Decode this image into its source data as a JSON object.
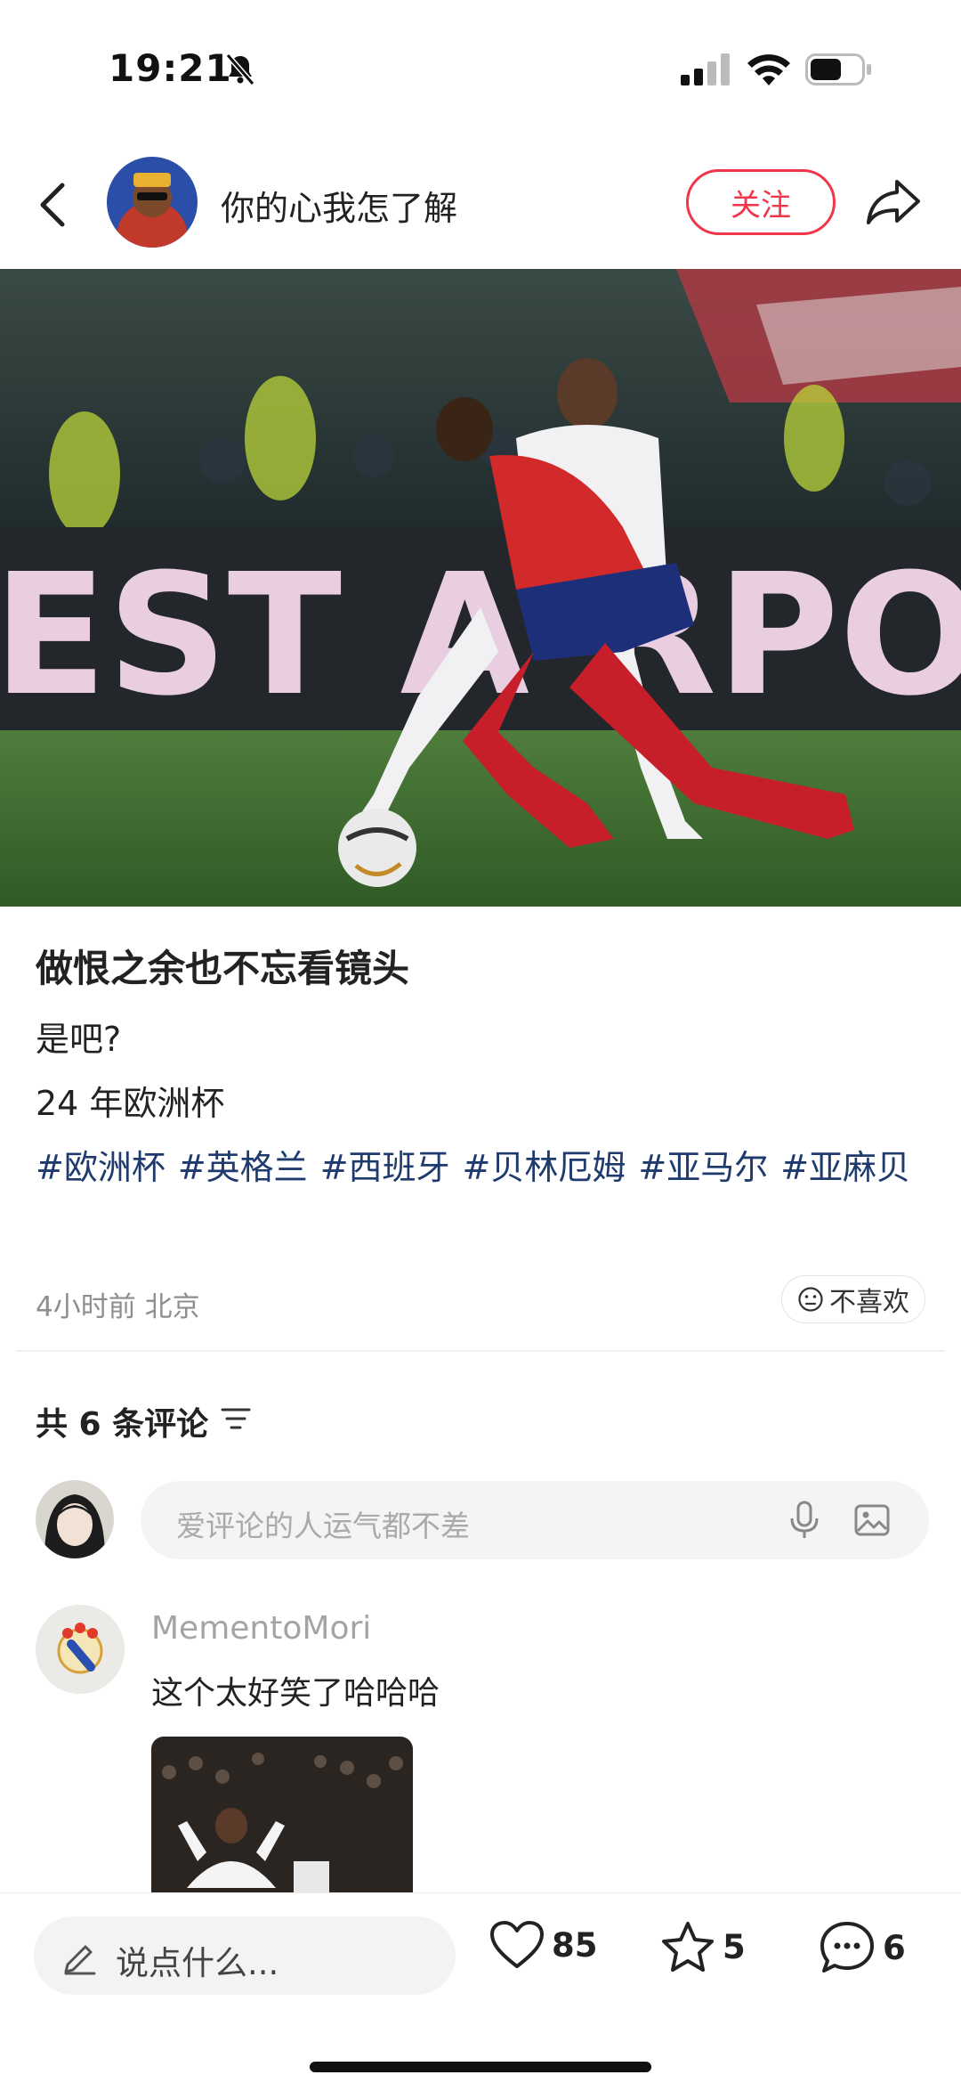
{
  "status_bar": {
    "time": "19:21"
  },
  "header": {
    "author_name": "你的心我怎了解",
    "follow_label": "关注"
  },
  "post": {
    "title": "做恨之余也不忘看镜头",
    "lines": [
      "是吧?",
      "24 年欧洲杯"
    ],
    "tags": [
      "#欧洲杯",
      "#英格兰",
      "#西班牙",
      "#贝林厄姆",
      "#亚马尔",
      "#亚麻贝"
    ],
    "image_text": "EST A RPO",
    "meta": "4小时前 北京",
    "dislike_label": "不喜欢"
  },
  "comments": {
    "count_label": "共 6 条评论",
    "input_placeholder": "爱评论的人运气都不差",
    "items": [
      {
        "user": "MementoMori",
        "text": "这个太好笑了哈哈哈"
      }
    ]
  },
  "bottom_bar": {
    "say_placeholder": "说点什么...",
    "likes": "85",
    "stars": "5",
    "comments": "6"
  },
  "colors": {
    "accent": "#f0364b",
    "tag": "#1f3b6e"
  },
  "icons": [
    "bell-slash-icon",
    "signal-icon",
    "wifi-icon",
    "battery-icon",
    "back-icon",
    "share-icon",
    "filter-icon",
    "mic-icon",
    "image-icon",
    "pencil-icon",
    "heart-icon",
    "star-icon",
    "comment-icon",
    "smile-icon"
  ]
}
